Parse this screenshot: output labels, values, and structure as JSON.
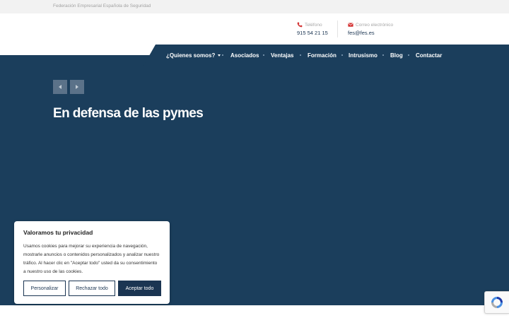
{
  "topbar": {
    "org_name": "Federación Empresarial Española de Seguridad"
  },
  "contacts": {
    "phone": {
      "label": "Teléfono",
      "value": "915 54 21 15",
      "icon": "phone-icon"
    },
    "email": {
      "label": "Correo electrónico",
      "value": "fes@fes.es",
      "icon": "envelope-icon"
    }
  },
  "nav": {
    "items": [
      {
        "label": "¿Quienes somos?"
      },
      {
        "label": "Asociados"
      },
      {
        "label": "Ventajas"
      },
      {
        "label": "Formación"
      },
      {
        "label": "Intrusismo"
      },
      {
        "label": "Blog"
      },
      {
        "label": "Contactar"
      }
    ]
  },
  "hero": {
    "title": "En defensa de las pymes"
  },
  "cookie": {
    "title": "Valoramos tu privacidad",
    "body": "Usamos cookies para mejorar su experiencia de navegación, mostrarle anuncios o contenidos personalizados y analizar nuestro tráfico. Al hacer clic en \"Aceptar todo\" usted da su consentimiento a nuestro uso de las cookies.",
    "customize_label": "Personalizar",
    "reject_label": "Rechazar todo",
    "accept_label": "Aceptar todo"
  },
  "colors": {
    "primary": "#1b3e5c",
    "accent": "#d32f2f",
    "topbar": "#f2f2f2"
  }
}
